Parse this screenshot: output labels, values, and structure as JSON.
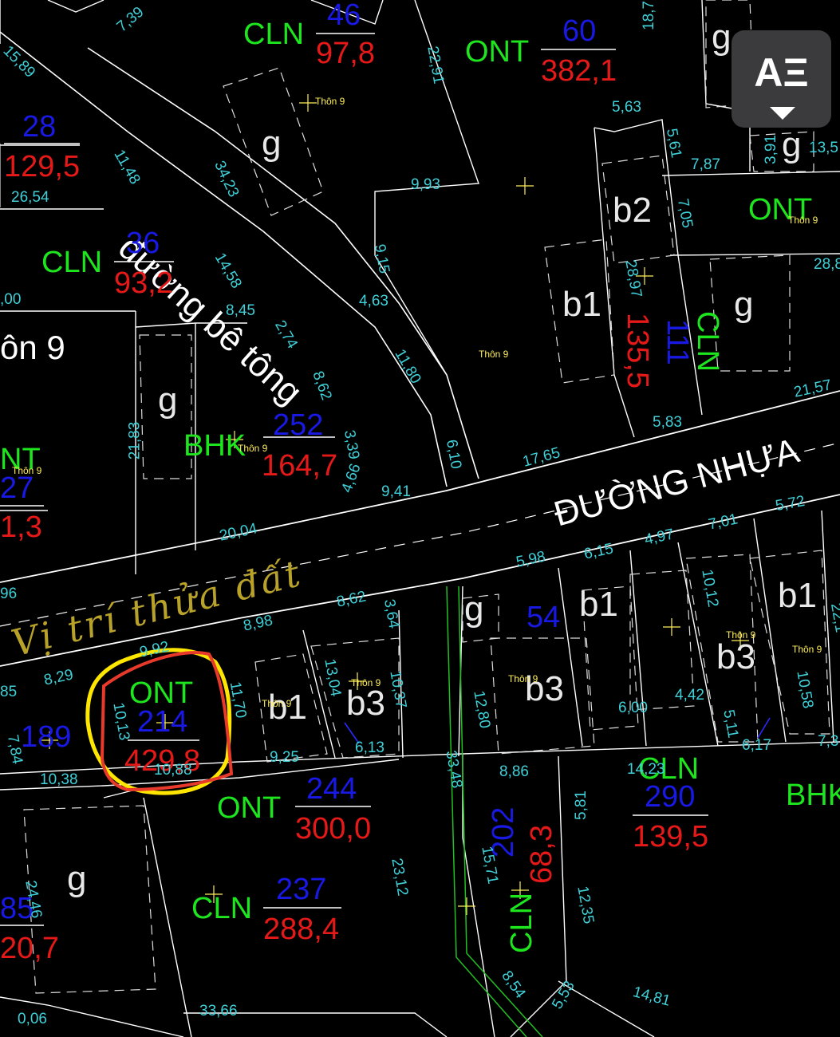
{
  "map": {
    "roads": {
      "concrete": "đường bê tông",
      "asphalt": "ĐƯỜNG NHỰA"
    },
    "handwritten_note": "Vị trí thửa đất",
    "village_label": "ôn 9",
    "place_labels": [
      "Thôn 9",
      "Thôn 9",
      "Thôn 9",
      "Thôn 9",
      "Thôn 9",
      "Thôn 9",
      "Thôn 9",
      "Thôn 9",
      "Thôn 9",
      "Thôn 9"
    ],
    "parcels": [
      {
        "use": "CLN",
        "number": "46",
        "area": "97,8"
      },
      {
        "use": "ONT",
        "number": "60",
        "area": "382,1"
      },
      {
        "use": "",
        "number": "28",
        "area": "129,5"
      },
      {
        "use": "CLN",
        "number": "36",
        "area": "93,2"
      },
      {
        "use": "BHK",
        "number": "252",
        "area": "164,7"
      },
      {
        "use": "NT",
        "number": "27",
        "area": "1,3"
      },
      {
        "use": "CLN",
        "number": "111",
        "area": "135,5"
      },
      {
        "use": "ONT",
        "number": "",
        "area": ""
      },
      {
        "use": "ONT",
        "number": "214",
        "area": "429,8"
      },
      {
        "use": "ONT",
        "number": "244",
        "area": "300,0"
      },
      {
        "use": "CLN",
        "number": "290",
        "area": "139,5"
      },
      {
        "use": "CLN",
        "number": "237",
        "area": "288,4"
      },
      {
        "use": "CLN",
        "number": "202",
        "area": "68,3"
      },
      {
        "use": "BHK",
        "number": "",
        "area": ""
      },
      {
        "use": "",
        "number": "189",
        "area": ""
      },
      {
        "use": "",
        "number": "54",
        "area": ""
      },
      {
        "use": "",
        "number": "85",
        "area": "20,7"
      }
    ],
    "building_symbols": [
      "g",
      "g",
      "g",
      "g",
      "g",
      "g",
      "g",
      "b1",
      "b2",
      "b1",
      "b3",
      "b1",
      "b3",
      "b1",
      "b3"
    ],
    "dimensions": [
      "7,39",
      "15,89",
      "22,91",
      "18,7",
      "11,48",
      "26,54",
      "34,23",
      "9,93",
      "5,63",
      "5,61",
      "7,87",
      "3,91",
      "13,5",
      "7,05",
      "28,97",
      "28,8",
      "14,58",
      "9,15",
      "4,63",
      ",00",
      "8,45",
      "2,74",
      "11,80",
      "21,57",
      "5,83",
      "21,83",
      "8,62",
      "3,39",
      "4,66",
      "17,65",
      "6,10",
      "9,41",
      "20,04",
      "5,72",
      "7,01",
      "4,97",
      "6,15",
      "5,98",
      "8,62",
      "3,64",
      "8,98",
      "9,92",
      "8,29",
      "10,12",
      "10,13",
      "11,70",
      "13,04",
      "10,37",
      "12,80",
      "6,13",
      "9,25",
      "10,88",
      "10,38",
      "33,48",
      "8,86",
      "5,81",
      "6,00",
      "4,42",
      "5,11",
      "6,17",
      "10,58",
      "15,71",
      "23,12",
      "12,35",
      "8,54",
      "5,53",
      "14,81",
      "33,66",
      "0,06",
      "24,46",
      "96",
      "85",
      "7,84",
      "7,3",
      "22,1",
      "14,23"
    ],
    "circled_parcel_number": "214"
  },
  "toolbar": {
    "text_style_button": {
      "label": "AΞ",
      "icon": "text-format-icon"
    }
  },
  "colors": {
    "background": "#000000",
    "boundary": "#ffffff",
    "land_use": "#1ee61e",
    "parcel_number": "#1919e6",
    "area": "#e61919",
    "dimension": "#3fd0d8",
    "highlight_red": "#e83a2a",
    "highlight_yellow": "#ffe600",
    "handwriting": "#b8a22a",
    "canal": "#22c022"
  }
}
